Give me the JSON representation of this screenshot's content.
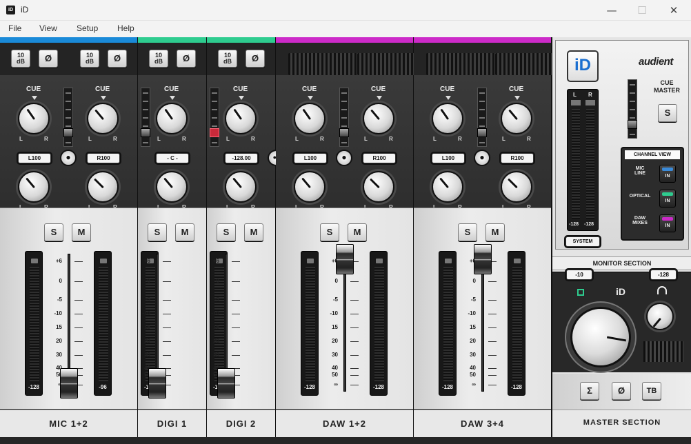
{
  "window": {
    "title": "iD",
    "app_icon": "iD",
    "min": "—",
    "max": "☐",
    "close": "✕"
  },
  "menu": [
    "File",
    "View",
    "Setup",
    "Help"
  ],
  "colors": {
    "blue": "#1a8ad8",
    "green": "#2ecc8f",
    "magenta": "#cc2ac8",
    "accent_red": "#d22a3c"
  },
  "strips": [
    {
      "name": "MIC 1+2",
      "color": "#1a8ad8",
      "cue": [
        "CUE",
        "CUE"
      ],
      "pan": [
        "L100",
        "R100"
      ],
      "link": "●",
      "meters": [
        "-128",
        "-96"
      ],
      "s": "S",
      "m": "M",
      "pad": "10\ndB",
      "phase": "Ø",
      "lr": [
        "L",
        "R"
      ]
    },
    {
      "name": "DIGI 1",
      "color": "#2ecc8f",
      "cue": [
        "CUE"
      ],
      "pan": [
        "- C -"
      ],
      "meters": [
        "-128"
      ],
      "s": "S",
      "m": "M",
      "pad": "10\ndB",
      "phase": "Ø",
      "lr": [
        "L",
        "R"
      ]
    },
    {
      "name": "DIGI 2",
      "color": "#2ecc8f",
      "cue": [
        "CUE"
      ],
      "pan": [
        "-128.00"
      ],
      "link": "●●",
      "meters": [
        "-128"
      ],
      "s": "S",
      "m": "M",
      "pad": "10\ndB",
      "phase": "Ø",
      "lr": [
        "L",
        "R"
      ]
    },
    {
      "name": "DAW 1+2",
      "color": "#cc2ac8",
      "cue": [
        "CUE",
        "CUE"
      ],
      "pan": [
        "L100",
        "R100"
      ],
      "link": "●",
      "meters": [
        "-128",
        "-128"
      ],
      "s": "S",
      "m": "M",
      "lr": [
        "L",
        "R"
      ]
    },
    {
      "name": "DAW 3+4",
      "color": "#cc2ac8",
      "cue": [
        "CUE",
        "CUE"
      ],
      "pan": [
        "L100",
        "R100"
      ],
      "link": "●",
      "meters": [
        "-128",
        "-128"
      ],
      "s": "S",
      "m": "M",
      "lr": [
        "L",
        "R"
      ]
    }
  ],
  "fader_scale": [
    "+6",
    "0",
    "-5",
    "-10",
    "15",
    "20",
    "30",
    "40",
    "50",
    "∞"
  ],
  "master": {
    "logo": "iD",
    "brand": "audient",
    "meter_lr": [
      "L",
      "R"
    ],
    "meter_vals": [
      "-128",
      "-128"
    ],
    "system": "SYSTEM",
    "cue_master": "CUE\nMASTER",
    "solo": "S",
    "channel_view": {
      "title": "CHANNEL VIEW",
      "rows": [
        {
          "label": "MIC\nLINE",
          "btn": "IN",
          "color": "#3a8ad8"
        },
        {
          "label": "OPTICAL",
          "btn": "IN",
          "color": "#2ecc8f"
        },
        {
          "label": "DAW\nMIXES",
          "btn": "IN",
          "color": "#cc2ac8"
        }
      ]
    },
    "monitor_section": "MONITOR SECTION",
    "speaker_level": "-10",
    "phones_level": "-128",
    "mon_logo": "iD",
    "buttons": [
      "Σ",
      "Ø",
      "TB"
    ],
    "footer": "MASTER SECTION"
  }
}
